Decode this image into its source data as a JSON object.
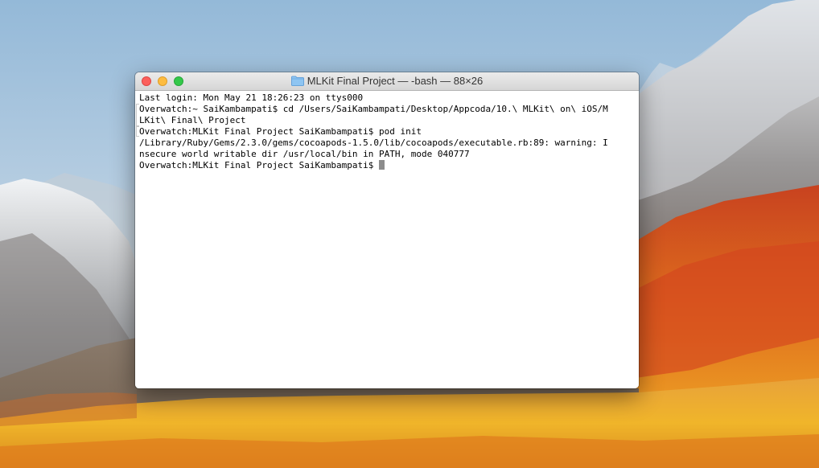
{
  "window": {
    "title": "MLKit Final Project — -bash — 88×26",
    "folder_icon": "folder-icon"
  },
  "terminal": {
    "lines": [
      "Last login: Mon May 21 18:26:23 on ttys000",
      "Overwatch:~ SaiKambampati$ cd /Users/SaiKambampati/Desktop/Appcoda/10.\\ MLKit\\ on\\ iOS/M",
      "LKit\\ Final\\ Project",
      "Overwatch:MLKit Final Project SaiKambampati$ pod init",
      "/Library/Ruby/Gems/2.3.0/gems/cocoapods-1.5.0/lib/cocoapods/executable.rb:89: warning: I",
      "nsecure world writable dir /usr/local/bin in PATH, mode 040777"
    ],
    "prompt": "Overwatch:MLKit Final Project SaiKambampati$"
  },
  "colors": {
    "close": "#fc605c",
    "minimize": "#fdbc40",
    "maximize": "#34c84a",
    "cursor": "#8c8c8c",
    "folder": "#6cb4f0"
  }
}
